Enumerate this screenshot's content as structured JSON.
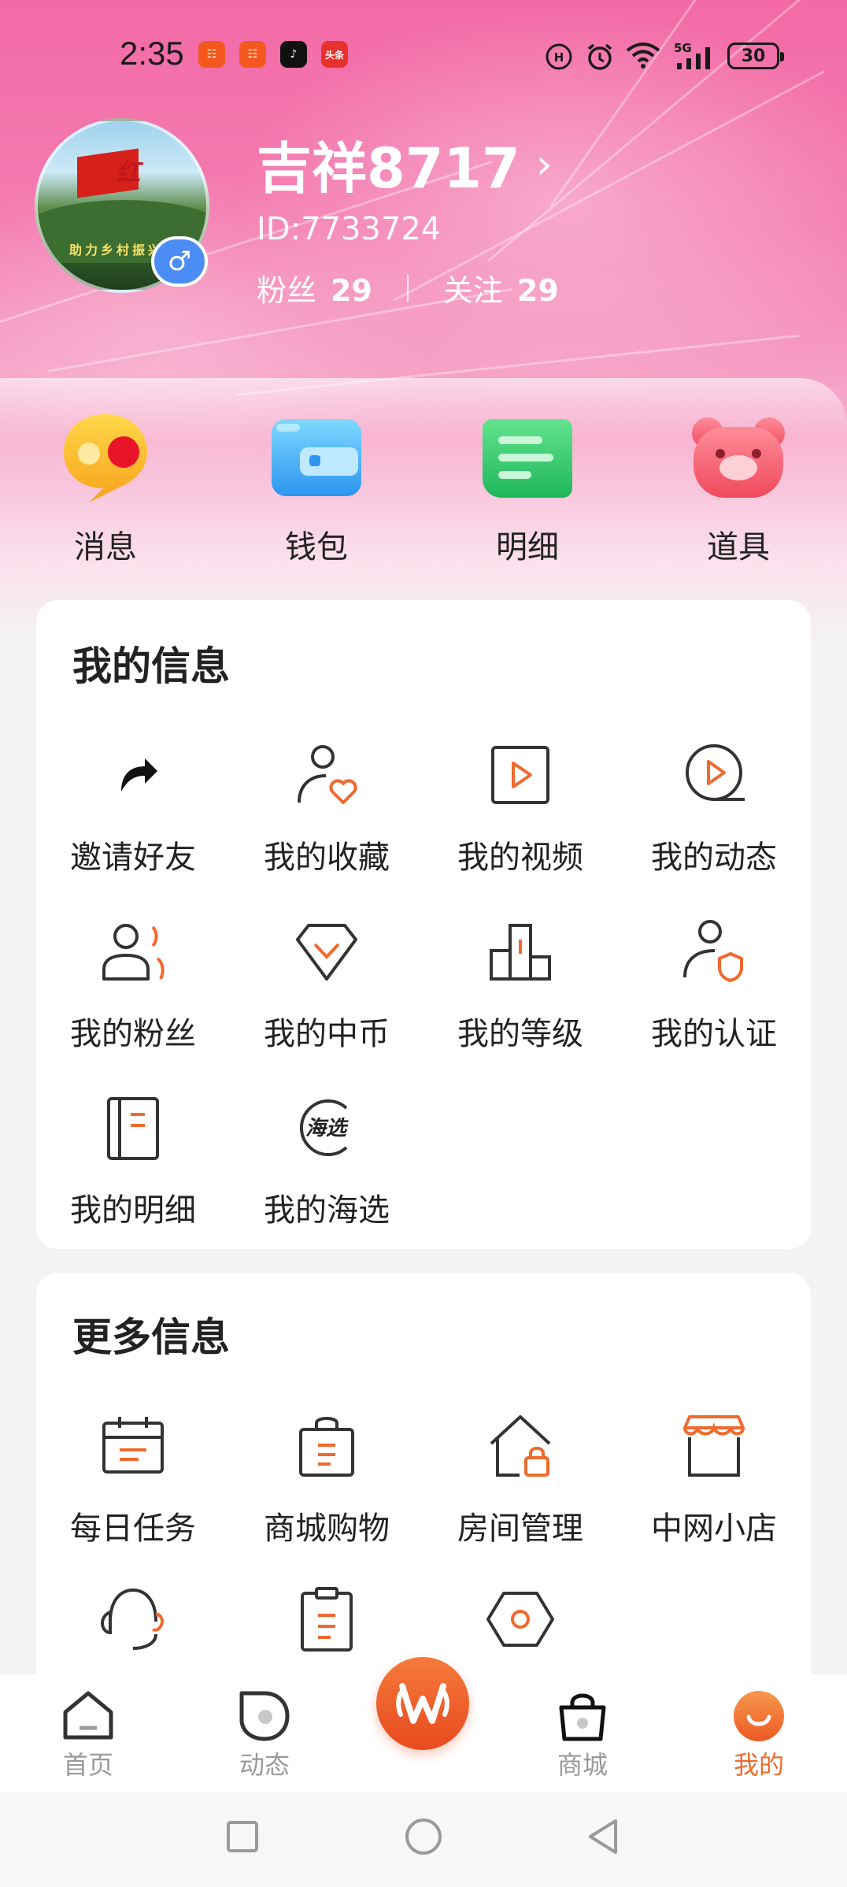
{
  "status_bar": {
    "time": "2:35",
    "battery": "30",
    "network": "5G",
    "app_icons": [
      "app-icon-1",
      "app-icon-2",
      "tiktok-icon",
      "toutiao-icon"
    ],
    "toutiao_label": "头条"
  },
  "profile": {
    "username": "吉祥8717",
    "id_text": "ID:7733724",
    "fans_label": "粉丝",
    "fans_count": "29",
    "follow_label": "关注",
    "follow_count": "29",
    "gender": "♂"
  },
  "quick_actions": [
    {
      "label": "消息",
      "icon": "message-bubble-icon"
    },
    {
      "label": "钱包",
      "icon": "wallet-icon"
    },
    {
      "label": "明细",
      "icon": "details-icon"
    },
    {
      "label": "道具",
      "icon": "bear-icon"
    }
  ],
  "my_info": {
    "title": "我的信息",
    "items": [
      {
        "label": "邀请好友",
        "icon": "share-arrow-icon"
      },
      {
        "label": "我的收藏",
        "icon": "user-heart-icon"
      },
      {
        "label": "我的视频",
        "icon": "video-play-icon"
      },
      {
        "label": "我的动态",
        "icon": "moments-play-icon"
      },
      {
        "label": "我的粉丝",
        "icon": "fans-icon"
      },
      {
        "label": "我的中币",
        "icon": "diamond-icon"
      },
      {
        "label": "我的等级",
        "icon": "level-bars-icon"
      },
      {
        "label": "我的认证",
        "icon": "user-shield-icon"
      },
      {
        "label": "我的明细",
        "icon": "notebook-icon"
      },
      {
        "label": "我的海选",
        "icon": "audition-icon"
      }
    ],
    "audition_badge": "海选"
  },
  "more_info": {
    "title": "更多信息",
    "items": [
      {
        "label": "每日任务",
        "icon": "calendar-icon"
      },
      {
        "label": "商城购物",
        "icon": "shopping-bag-icon"
      },
      {
        "label": "房间管理",
        "icon": "house-lock-icon"
      },
      {
        "label": "中网小店",
        "icon": "shop-icon"
      },
      {
        "label": "",
        "icon": "headset-icon"
      },
      {
        "label": "",
        "icon": "clipboard-icon"
      },
      {
        "label": "",
        "icon": "hexagon-settings-icon"
      }
    ]
  },
  "bottom_nav": [
    {
      "label": "首页",
      "icon": "home-icon",
      "active": false
    },
    {
      "label": "动态",
      "icon": "moments-icon",
      "active": false
    },
    {
      "label": "",
      "icon": "center-logo-icon",
      "active": false
    },
    {
      "label": "商城",
      "icon": "shop-bag-icon",
      "active": false
    },
    {
      "label": "我的",
      "icon": "mine-icon",
      "active": true
    }
  ],
  "colors": {
    "accent": "#ef6a2e",
    "hero_pink": "#f36aa6",
    "gender_blue": "#4b8cf5"
  }
}
